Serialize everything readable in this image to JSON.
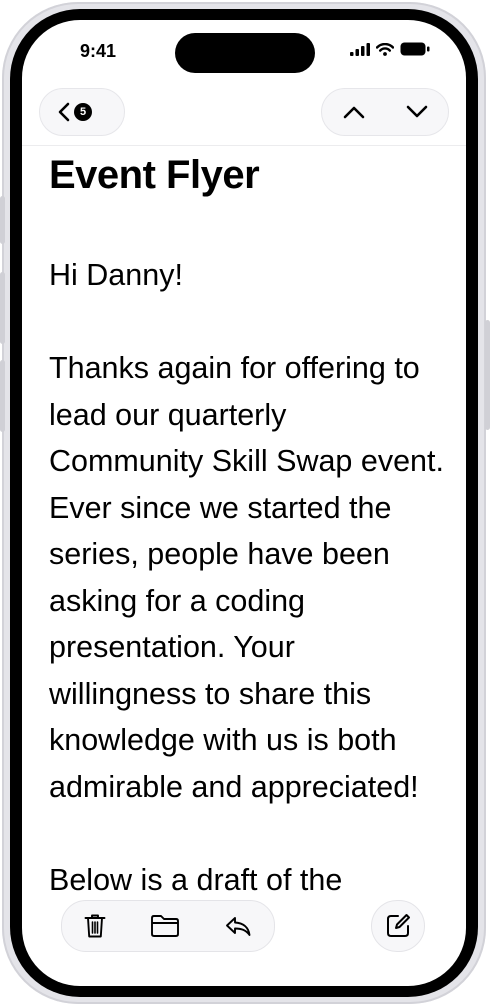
{
  "status_bar": {
    "time": "9:41"
  },
  "nav": {
    "back_count": "5"
  },
  "note": {
    "title": "Event Flyer",
    "paragraphs": [
      "Hi Danny!",
      "Thanks again for offering to lead our quarterly Community Skill Swap event. Ever since we started the series, people have been asking for a coding presentation. Your willingness to share this knowledge with us is both admirable and appreciated!",
      "Below is a draft of the"
    ]
  },
  "toolbar": {
    "icons": [
      "trash-icon",
      "folder-icon",
      "reply-icon",
      "compose-icon"
    ]
  }
}
